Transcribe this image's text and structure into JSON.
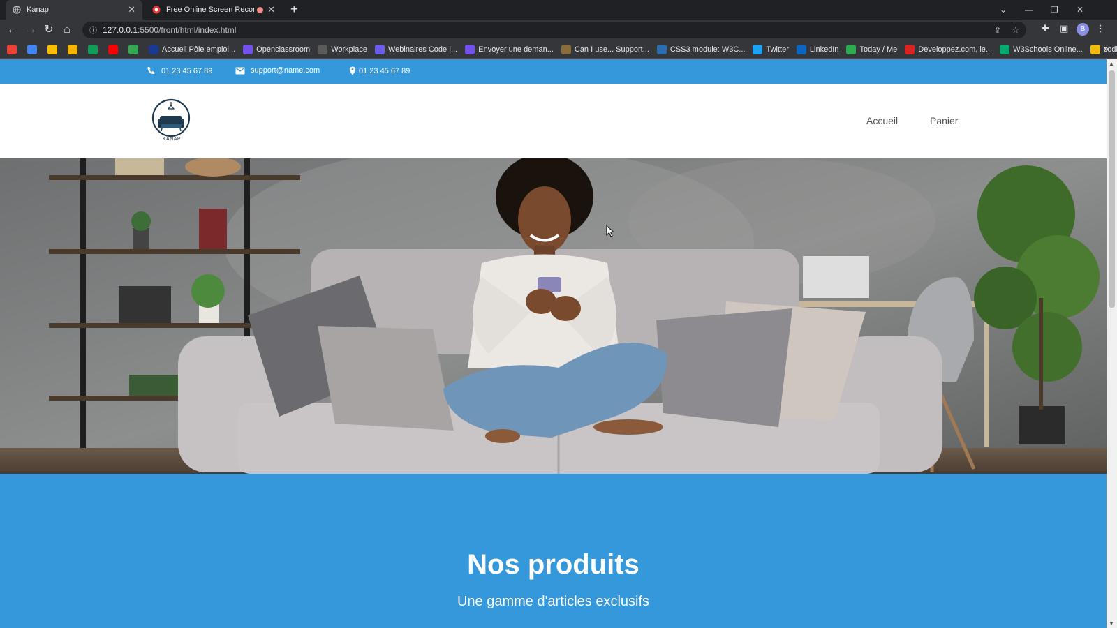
{
  "browser": {
    "tabs": [
      {
        "title": "Kanap",
        "active": true
      },
      {
        "title": "Free Online Screen Recorder",
        "active": false
      }
    ],
    "url_host": "127.0.0.1",
    "url_path": ":5500/front/html/index.html",
    "profile_initial": "B",
    "bookmarks": [
      {
        "label": "",
        "icon": "gmail-icon",
        "color": "#ea4335"
      },
      {
        "label": "",
        "icon": "calendar-icon",
        "color": "#4285f4"
      },
      {
        "label": "",
        "icon": "keep-icon",
        "color": "#fbbc04"
      },
      {
        "label": "",
        "icon": "slides-icon",
        "color": "#f4b400"
      },
      {
        "label": "",
        "icon": "drive-icon",
        "color": "#0f9d58"
      },
      {
        "label": "",
        "icon": "youtube-icon",
        "color": "#ff0000"
      },
      {
        "label": "",
        "icon": "maps-icon",
        "color": "#34a853"
      },
      {
        "label": "Accueil Pôle emploi...",
        "icon": "pole-emploi-icon",
        "color": "#1a3a8f"
      },
      {
        "label": "Openclassroom",
        "icon": "openclassrooms-icon",
        "color": "#7451eb"
      },
      {
        "label": "Workplace",
        "icon": "workplace-icon",
        "color": "#5a5a5a"
      },
      {
        "label": "Webinaires Code |...",
        "icon": "webinar-icon",
        "color": "#6c5ce7"
      },
      {
        "label": "Envoyer une deman...",
        "icon": "openclassrooms-icon",
        "color": "#7451eb"
      },
      {
        "label": "Can I use... Support...",
        "icon": "caniuse-icon",
        "color": "#8a6d3b"
      },
      {
        "label": "CSS3 module: W3C...",
        "icon": "w3c-icon",
        "color": "#2a6db0"
      },
      {
        "label": "Twitter",
        "icon": "twitter-icon",
        "color": "#1da1f2"
      },
      {
        "label": "LinkedIn",
        "icon": "linkedin-icon",
        "color": "#0a66c2"
      },
      {
        "label": "Today / Me",
        "icon": "today-icon",
        "color": "#2eaa4f"
      },
      {
        "label": "Developpez.com, le...",
        "icon": "developpez-icon",
        "color": "#d22"
      },
      {
        "label": "W3Schools Online...",
        "icon": "w3schools-icon",
        "color": "#04aa6d"
      },
      {
        "label": "codingame",
        "icon": "codingame-icon",
        "color": "#f2bb13"
      }
    ]
  },
  "site": {
    "topbar": {
      "phone": "01 23 45 67 89",
      "email": "support@name.com",
      "address": "01 23 45 67 89"
    },
    "logo_text": "KANAP",
    "nav": {
      "home": "Accueil",
      "cart": "Panier"
    },
    "products": {
      "title": "Nos produits",
      "subtitle": "Une gamme d'articles exclusifs"
    },
    "colors": {
      "accent": "#3498db"
    }
  }
}
